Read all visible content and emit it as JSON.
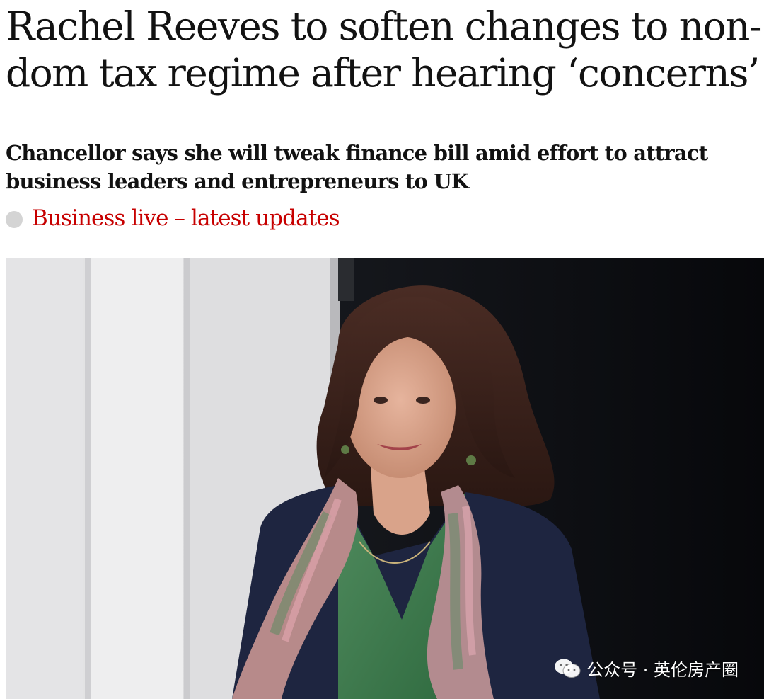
{
  "article": {
    "headline": "Rachel Reeves to soften changes to non-dom tax regime after hearing ‘concerns’",
    "standfirst": "Chancellor says she will tweak finance bill amid effort to attract business leaders and entrepreneurs to UK",
    "live_link": {
      "label": "Business live – latest updates",
      "color": "#c70000",
      "dot_color": "#d4d4d4"
    }
  },
  "image": {
    "subject": "portrait-photo",
    "watermark": {
      "icon": "wechat-icon",
      "text": "公众号 · 英伦房产圈"
    }
  }
}
